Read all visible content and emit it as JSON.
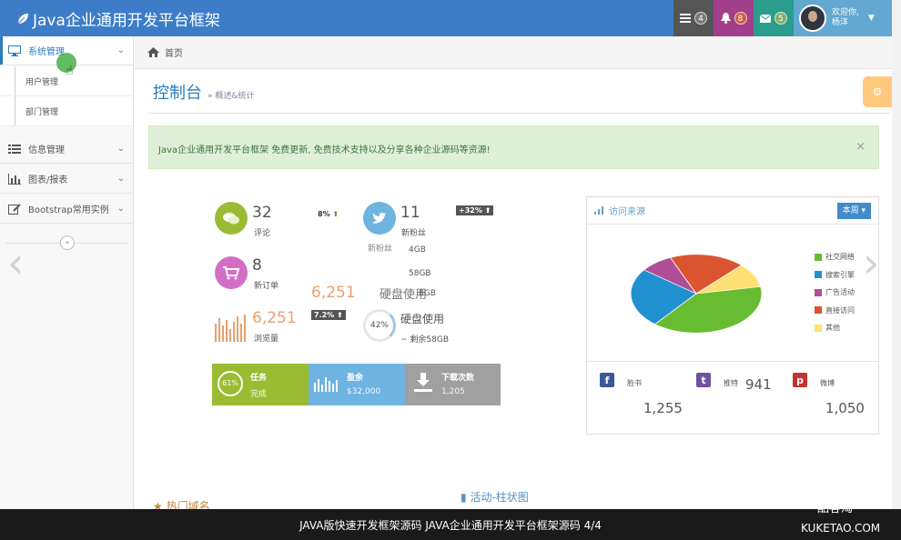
{
  "navbar": {
    "brand": "Java企业通用开发平台框架",
    "tasks_count": "4",
    "notifications_count": "8",
    "messages_count": "5",
    "welcome": "欢迎你,",
    "username": "杨洋",
    "colors": {
      "bar": "#3d7dc8",
      "tasks": "#555555",
      "notifications": "#a23f8a",
      "messages": "#2a9d8f",
      "user": "#62a8d1"
    }
  },
  "sidebar": {
    "items": [
      {
        "label": "系统管理",
        "icon": "desktop-icon"
      },
      {
        "label": "信息管理",
        "icon": "list-icon"
      },
      {
        "label": "图表/报表",
        "icon": "bar-chart-icon"
      },
      {
        "label": "Bootstrap常用实例",
        "icon": "edit-icon"
      }
    ],
    "subitems": [
      "用户管理",
      "部门管理"
    ],
    "collapse": "«"
  },
  "breadcrumb": {
    "home": "首页"
  },
  "page": {
    "title": "控制台",
    "subtitle": "» 概述&统计"
  },
  "alert": {
    "text": "Java企业通用开发平台框架 免费更新, 免费技术支持以及分享各种企业源码等资源!",
    "close": "×"
  },
  "infoboxes": {
    "comments": {
      "num": "32",
      "label": "评论",
      "badge": "8%"
    },
    "followers": {
      "num": "11",
      "label": "新粉丝",
      "badge": "+32%"
    },
    "orders": {
      "num": "8",
      "label": "新订单"
    },
    "views": {
      "num": "6,251",
      "label": "浏览量",
      "badge": "7.2%"
    },
    "ghost": {
      "num": "6,251",
      "text1": "新粉丝",
      "text2": "4GB",
      "text3": "58GB",
      "text4": "硬盘使用",
      "text5": "8GB"
    },
    "disk": {
      "percent": "42%",
      "label": "硬盘使用",
      "sub": "~ 剩余58GB"
    }
  },
  "tiles": [
    {
      "title": "任务",
      "sub": "完成",
      "percent": "61%",
      "color": "#9abc32"
    },
    {
      "title": "盈余",
      "sub": "$32,000",
      "color": "#6fb3e0"
    },
    {
      "title": "下载次数",
      "sub": "1,205",
      "color": "#a0a0a0"
    }
  ],
  "visits": {
    "title": "访问来源",
    "period": "本周",
    "legend": [
      "社交网络",
      "搜索引擎",
      "广告活动",
      "直接访问",
      "其他"
    ],
    "stats": [
      {
        "icon": "f",
        "label": "脸书",
        "value": "1,255",
        "color": "#3b5998"
      },
      {
        "icon": "t",
        "label": "推特",
        "value": "941",
        "color": "#6f52a3"
      },
      {
        "icon": "p",
        "label": "微博",
        "value": "1,050",
        "color": "#c2342d"
      }
    ]
  },
  "chart_data": {
    "type": "pie",
    "title": "访问来源",
    "categories": [
      "社交网络",
      "搜索引擎",
      "广告活动",
      "直接访问",
      "其他"
    ],
    "values": [
      38.7,
      24.5,
      8.2,
      18.6,
      10.0
    ],
    "colors": [
      "#68bc31",
      "#2091cf",
      "#af4e96",
      "#da5430",
      "#fee074"
    ],
    "legend": "right"
  },
  "bottom": {
    "hot_domains": "热门域名",
    "bar_chart": "活动-柱状图"
  },
  "caption": {
    "text": "JAVA版快速开发框架源码 JAVA企业通用开发平台框架源码   4/4",
    "watermark_brand": "酷客淘",
    "watermark_url": "KUKETAO.COM"
  }
}
